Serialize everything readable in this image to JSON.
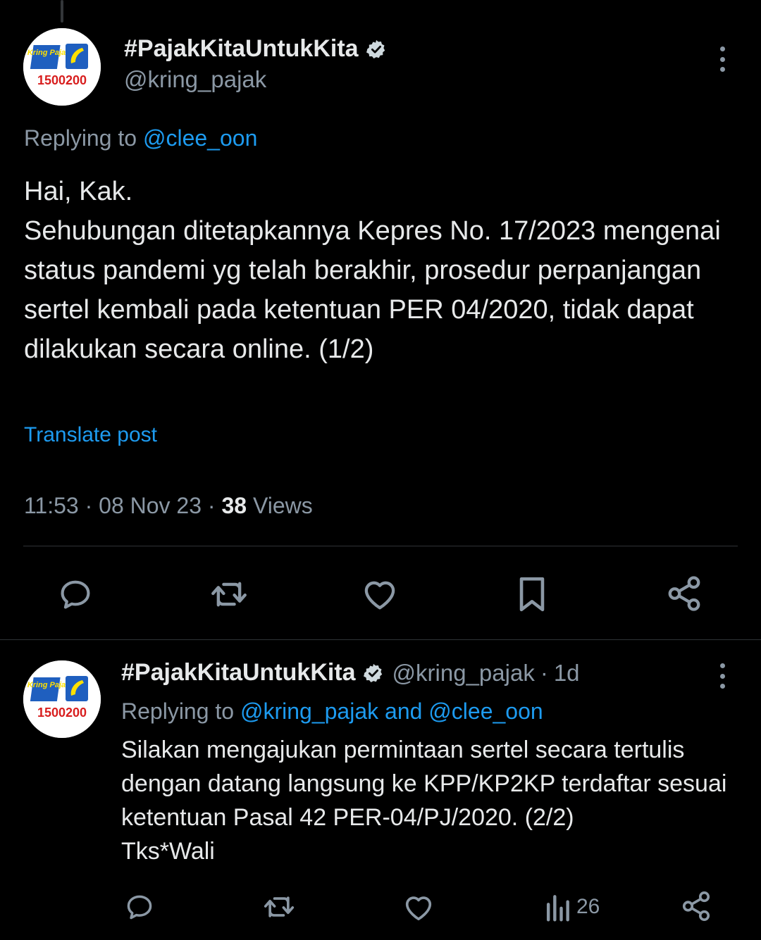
{
  "main_post": {
    "display_name": "#PajakKitaUntukKita",
    "handle": "@kring_pajak",
    "avatar": {
      "top_text": "Kring Pajak",
      "number": "1500200"
    },
    "replying_prefix": "Replying to",
    "replying_mention": "@clee_oon",
    "text": "Hai, Kak.\nSehubungan ditetapkannya Kepres No. 17/2023 mengenai status pandemi yg telah berakhir, prosedur perpanjangan sertel kembali pada ketentuan PER 04/2020, tidak dapat dilakukan secara online. (1/2)",
    "translate_label": "Translate post",
    "time": "11:53",
    "date": "08 Nov 23",
    "views_count": "38",
    "views_label": "Views",
    "separator": "·"
  },
  "reply_post": {
    "display_name": "#PajakKitaUntukKita",
    "handle": "@kring_pajak",
    "age": "1d",
    "avatar": {
      "top_text": "Kring Pajak",
      "number": "1500200"
    },
    "replying_prefix": "Replying to",
    "replying_mentions": "@kring_pajak and @clee_oon",
    "text": "Silakan mengajukan permintaan sertel secara tertulis dengan datang langsung ke KPP/KP2KP terdaftar sesuai ketentuan Pasal 42 PER-04/PJ/2020. (2/2)\nTks*Wali",
    "views_count": "26"
  },
  "colors": {
    "background": "#000000",
    "text_primary": "#e7e9ea",
    "text_secondary": "#8b98a5",
    "accent": "#1d9bf0",
    "divider": "#2f3336"
  },
  "icons": [
    "more-icon",
    "verified-badge-icon",
    "reply-icon",
    "repost-icon",
    "like-icon",
    "bookmark-icon",
    "share-icon",
    "views-icon"
  ]
}
